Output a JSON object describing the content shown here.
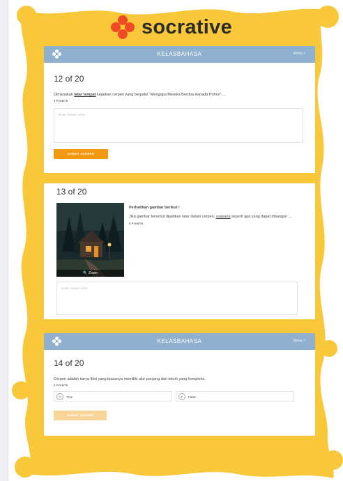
{
  "brand": {
    "name": "socrative",
    "accent": "#ef4a23",
    "frame_color": "#f8c73a"
  },
  "topbar": {
    "room": "KELASBAHASA",
    "menu_label": "Menu ˅"
  },
  "q12": {
    "number": "12 of 20",
    "text_before": "Dimanakah ",
    "text_bold": "latar tempat",
    "text_after": " kejadian cerpen yang berjudul “Mengapa Mereka Berdoa Kepada Pohon” ...",
    "points": "5 POINTS",
    "answer_placeholder": "Enter Answer Here",
    "submit_label": "SUBMIT ANSWER"
  },
  "q13": {
    "number": "13 of 20",
    "heading": "Perhatikan gambar berikut !",
    "text_before": "Jika gambar tersebut dijadikan latar dalam cerpen, ",
    "text_underline": "suasana",
    "text_after": " seperti apa yang dapat dibangun ...",
    "points": "5 POINTS",
    "zoom_label": "🔍 Zoom",
    "answer_placeholder": "Enter Answer Here"
  },
  "q14": {
    "number": "14 of 20",
    "text": "Cerpen adalah karya fiksi yang biasanya memiliki alur panjang dan tokoh yang kompleks.",
    "points": "5 POINTS",
    "choices": [
      {
        "key": "T",
        "label": "True"
      },
      {
        "key": "F",
        "label": "False"
      }
    ],
    "submit_label": "SUBMIT ANSWER"
  }
}
